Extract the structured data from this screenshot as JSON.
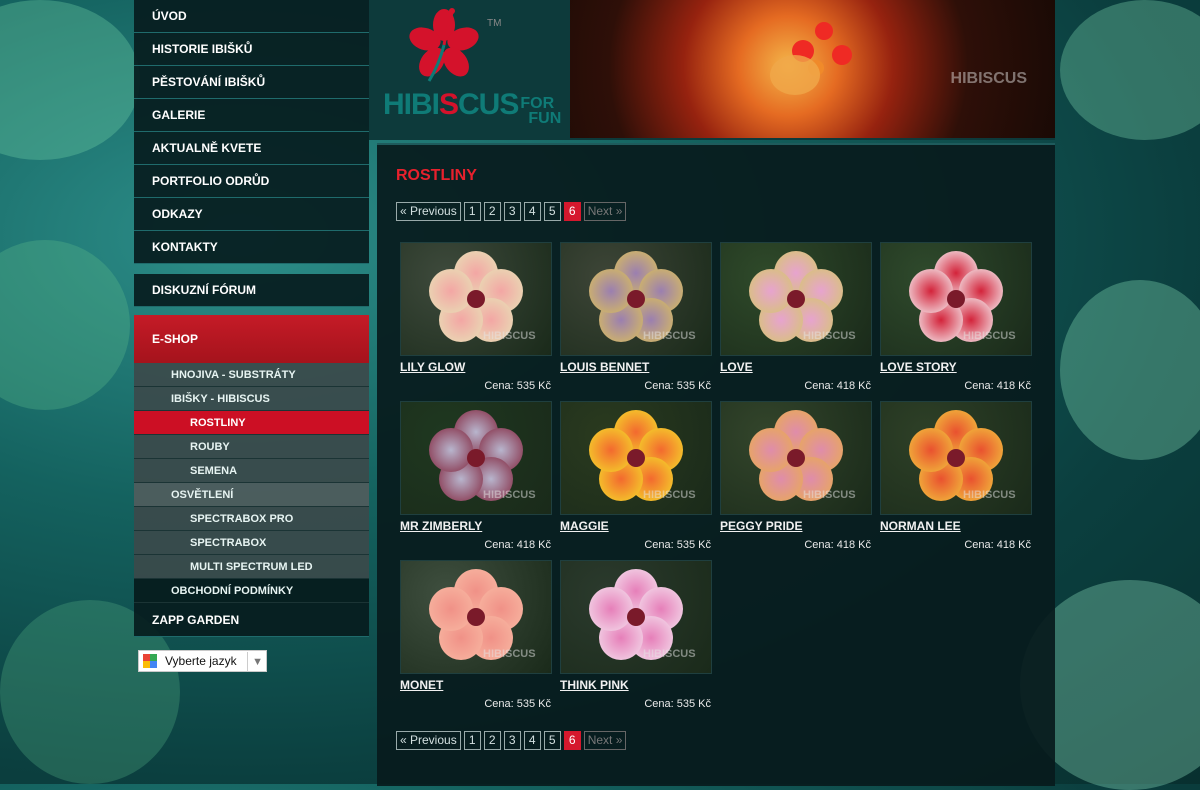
{
  "sidebar": {
    "items": [
      {
        "label": "ÚVOD"
      },
      {
        "label": "HISTORIE IBIŠKŮ"
      },
      {
        "label": "PĚSTOVÁNÍ IBIŠKŮ"
      },
      {
        "label": "GALERIE"
      },
      {
        "label": "AKTUALNĚ KVETE"
      },
      {
        "label": "PORTFOLIO ODRŮD"
      },
      {
        "label": "ODKAZY"
      },
      {
        "label": "KONTAKTY"
      }
    ],
    "forum": "DISKUZNÍ FÓRUM",
    "eshop": "E-SHOP",
    "sub": [
      {
        "label": "HNOJIVA - SUBSTRÁTY",
        "level": 1
      },
      {
        "label": "IBIŠKY - HIBISCUS",
        "level": 1
      },
      {
        "label": "ROSTLINY",
        "level": 2,
        "active": true
      },
      {
        "label": "ROUBY",
        "level": 2
      },
      {
        "label": "SEMENA",
        "level": 2
      },
      {
        "label": "OSVĚTLENÍ",
        "level": 1
      },
      {
        "label": "SPECTRABOX PRO",
        "level": 2
      },
      {
        "label": "SPECTRABOX",
        "level": 2
      },
      {
        "label": "MULTI SPECTRUM LED",
        "level": 2
      },
      {
        "label": "OBCHODNÍ PODMÍNKY",
        "level": 1
      }
    ],
    "zapp": "ZAPP GARDEN"
  },
  "language": {
    "label": "Vyberte jazyk",
    "arrow": "▼"
  },
  "header": {
    "logo_main_a": "HIBI",
    "logo_main_b": "S",
    "logo_main_c": "CUS",
    "logo_for": "FOR",
    "logo_fun": "FUN",
    "tm": "TM",
    "banner_wm": "HIBISCUS"
  },
  "page": {
    "title": "ROSTLINY"
  },
  "pager": {
    "prev": "« Previous",
    "pages": [
      "1",
      "2",
      "3",
      "4",
      "5",
      "6"
    ],
    "current": "6",
    "next": "Next »"
  },
  "products": [
    {
      "name": "LILY GLOW",
      "price": "Cena: 535 Kč",
      "c1": "#f3a6a4",
      "c2": "#e9d9b4",
      "bg": "#3e4a3c"
    },
    {
      "name": "LOUIS BENNET",
      "price": "Cena: 535 Kč",
      "c1": "#9b7fb0",
      "c2": "#d2b766",
      "bg": "#3d4537"
    },
    {
      "name": "LOVE",
      "price": "Cena: 418 Kč",
      "c1": "#e7a3cf",
      "c2": "#d8c27c",
      "bg": "#2f4a2a"
    },
    {
      "name": "LOVE STORY",
      "price": "Cena: 418 Kč",
      "c1": "#d3233a",
      "c2": "#f2d7dc",
      "bg": "#2f4a2c"
    },
    {
      "name": "MR ZIMBERLY",
      "price": "Cena: 418 Kč",
      "c1": "#b8b5cd",
      "c2": "#8a3b53",
      "bg": "#1f3820"
    },
    {
      "name": "MAGGIE",
      "price": "Cena: 535 Kč",
      "c1": "#f3692f",
      "c2": "#f4cc2a",
      "bg": "#2a3a1f"
    },
    {
      "name": "PEGGY PRIDE",
      "price": "Cena: 418 Kč",
      "c1": "#df8cab",
      "c2": "#e8a85d",
      "bg": "#33452b"
    },
    {
      "name": "NORMAN LEE",
      "price": "Cena: 418 Kč",
      "c1": "#e9512f",
      "c2": "#f1b43b",
      "bg": "#2e4027"
    },
    {
      "name": "MONET",
      "price": "Cena: 535 Kč",
      "c1": "#f09187",
      "c2": "#f7b39f",
      "bg": "#3f4f3f"
    },
    {
      "name": "THINK PINK",
      "price": "Cena: 535 Kč",
      "c1": "#e67fb9",
      "c2": "#f2d2e6",
      "bg": "#2b3a2d"
    }
  ],
  "product_wm": "HIBISCUS"
}
